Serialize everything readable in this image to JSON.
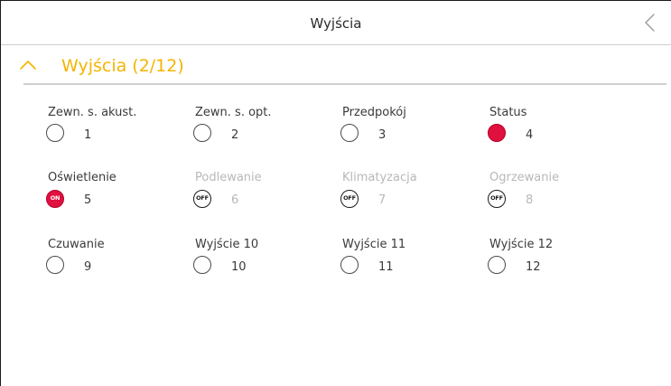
{
  "header": {
    "title": "Wyjścia",
    "back_icon": "chevron-left-icon"
  },
  "section": {
    "title": "Wyjścia (2/12)",
    "expanded": true,
    "accent_color": "#f5b400"
  },
  "colors": {
    "active": "#e0103f",
    "disabled_text": "#b8b8b8",
    "text": "#3a3a3a"
  },
  "outputs": [
    {
      "label": "Zewn. s. akust.",
      "number": "1",
      "state": "inactive"
    },
    {
      "label": "Zewn. s. opt.",
      "number": "2",
      "state": "inactive"
    },
    {
      "label": "Przedpokój",
      "number": "3",
      "state": "inactive"
    },
    {
      "label": "Status",
      "number": "4",
      "state": "active"
    },
    {
      "label": "Oświetlenie",
      "number": "5",
      "state": "on",
      "badge": "ON"
    },
    {
      "label": "Podlewanie",
      "number": "6",
      "state": "off-disabled",
      "badge": "OFF"
    },
    {
      "label": "Klimatyzacja",
      "number": "7",
      "state": "off-disabled",
      "badge": "OFF"
    },
    {
      "label": "Ogrzewanie",
      "number": "8",
      "state": "off-disabled",
      "badge": "OFF"
    },
    {
      "label": "Czuwanie",
      "number": "9",
      "state": "inactive"
    },
    {
      "label": "Wyjście 10",
      "number": "10",
      "state": "inactive"
    },
    {
      "label": "Wyjście 11",
      "number": "11",
      "state": "inactive"
    },
    {
      "label": "Wyjście 12",
      "number": "12",
      "state": "inactive"
    }
  ]
}
